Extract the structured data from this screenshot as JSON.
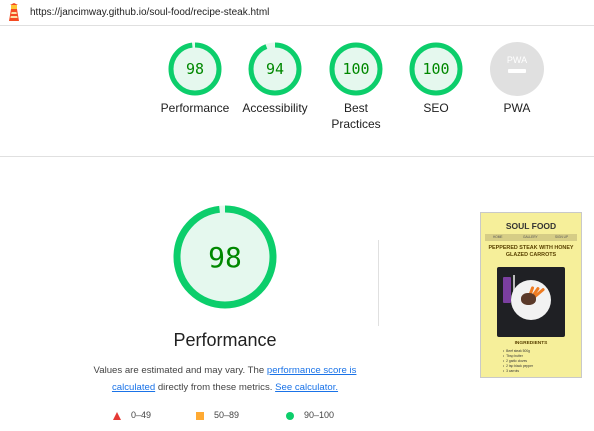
{
  "url": "https://jancimway.github.io/soul-food/recipe-steak.html",
  "colors": {
    "pass": "#0cce6b",
    "pass_text": "#008800",
    "pass_bg": "#e5f8ee",
    "na": "#cccccc",
    "na_bg": "#e0e0e0",
    "average": "#ffaa33",
    "fail": "#e53935",
    "link": "#1a73e8"
  },
  "categories": [
    {
      "score": 98,
      "label": "Performance",
      "status": "pass"
    },
    {
      "score": 94,
      "label": "Accessibility",
      "status": "pass"
    },
    {
      "score": 100,
      "label": "Best Practices",
      "status": "pass"
    },
    {
      "score": 100,
      "label": "SEO",
      "status": "pass"
    },
    {
      "score": null,
      "label": "PWA",
      "status": "na"
    }
  ],
  "pwa_badge": "PWA",
  "main": {
    "score": 98,
    "title": "Performance",
    "note_part1": "Values are estimated and may vary. The ",
    "link1": "performance score is calculated",
    "note_part2": " directly from these metrics. ",
    "link2": "See calculator."
  },
  "legend": [
    {
      "range": "0–49",
      "marker": "triangle-icon"
    },
    {
      "range": "50–89",
      "marker": "square-icon"
    },
    {
      "range": "90–100",
      "marker": "circle-icon"
    }
  ],
  "thumbnail": {
    "site_title": "SOUL FOOD",
    "nav": [
      "HOME",
      "GALLERY",
      "SIGN UP"
    ],
    "recipe_title": "PEPPERED STEAK WITH HONEY GLAZED CARROTS",
    "ingredients_heading": "INGREDIENTS",
    "ingredients": [
      "Beef steak 500g",
      "Tbsp butter",
      "2 garlic cloves",
      "2 tsp black pepper",
      "3 carrots"
    ]
  }
}
